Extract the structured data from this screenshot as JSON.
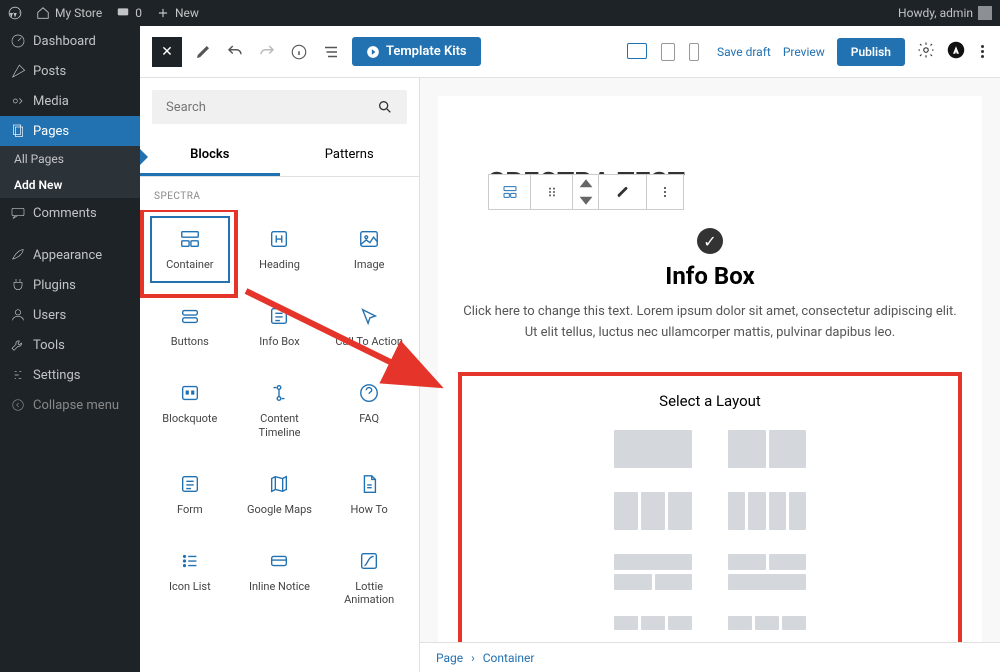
{
  "wpbar": {
    "site": "My Store",
    "comments": "0",
    "new": "New",
    "howdy": "Howdy, admin"
  },
  "sidebar": {
    "items": [
      {
        "label": "Dashboard",
        "icon": "dashboard"
      },
      {
        "label": "Posts",
        "icon": "pin"
      },
      {
        "label": "Media",
        "icon": "media"
      },
      {
        "label": "Pages",
        "icon": "pages"
      },
      {
        "label": "Comments",
        "icon": "comment"
      },
      {
        "label": "Appearance",
        "icon": "brush"
      },
      {
        "label": "Plugins",
        "icon": "plug"
      },
      {
        "label": "Users",
        "icon": "user"
      },
      {
        "label": "Tools",
        "icon": "wrench"
      },
      {
        "label": "Settings",
        "icon": "settings"
      },
      {
        "label": "Collapse menu",
        "icon": "collapse"
      }
    ],
    "sub": [
      "All Pages",
      "Add New"
    ]
  },
  "topbar": {
    "kits": "Template Kits",
    "save": "Save draft",
    "preview": "Preview",
    "publish": "Publish"
  },
  "inserter": {
    "search_ph": "Search",
    "tab_blocks": "Blocks",
    "tab_patterns": "Patterns",
    "group": "SPECTRA",
    "blocks": [
      "Container",
      "Heading",
      "Image",
      "Buttons",
      "Info Box",
      "Call To Action",
      "Blockquote",
      "Content Timeline",
      "FAQ",
      "Form",
      "Google Maps",
      "How To",
      "Icon List",
      "Inline Notice",
      "Lottie Animation"
    ]
  },
  "canvas": {
    "hidden_title": "SPECTRA TEST",
    "info_title": "Info Box",
    "info_text": "Click here to change this text. Lorem ipsum dolor sit amet, consectetur adipiscing elit. Ut elit tellus, luctus nec ullamcorper mattis, pulvinar dapibus leo.",
    "layout_title": "Select a Layout"
  },
  "crumbs": {
    "a": "Page",
    "sep": "›",
    "b": "Container"
  }
}
